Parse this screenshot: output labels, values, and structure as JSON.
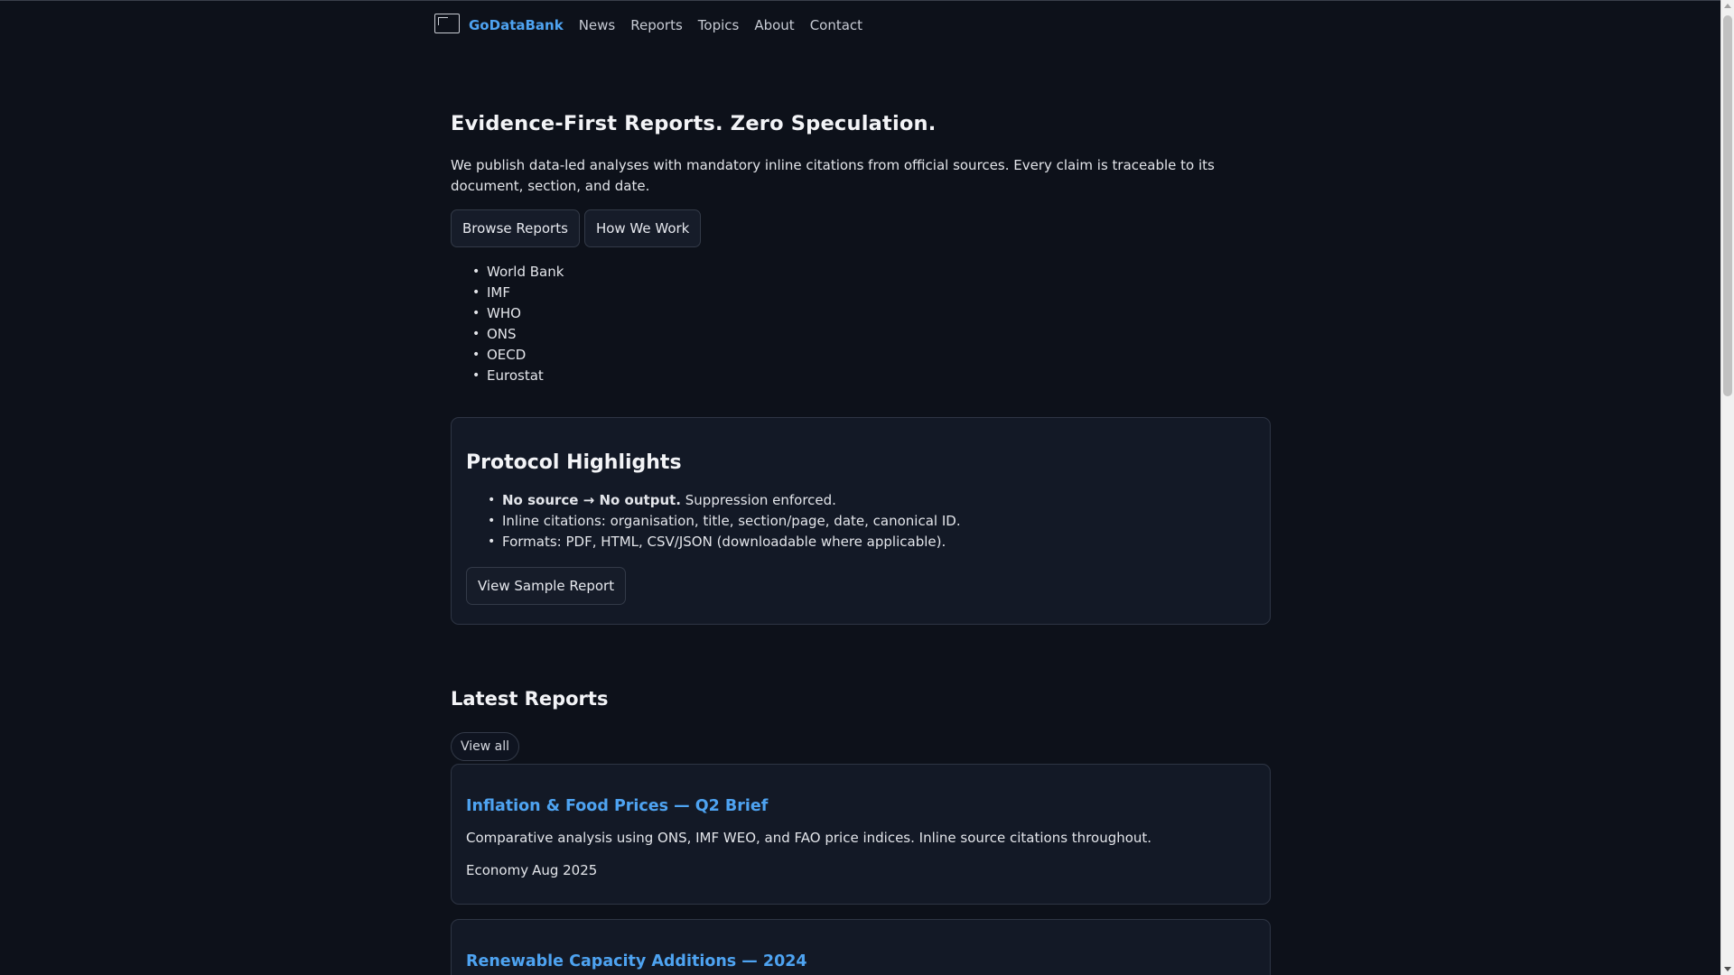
{
  "nav": {
    "brand": "GoDataBank",
    "links": [
      "News",
      "Reports",
      "Topics",
      "About",
      "Contact"
    ]
  },
  "hero": {
    "title": "Evidence-First Reports. Zero Speculation.",
    "description": "We publish data-led analyses with mandatory inline citations from official sources. Every claim is traceable to its document, section, and date.",
    "browse_label": "Browse Reports",
    "how_label": "How We Work",
    "sources": [
      "World Bank",
      "IMF",
      "WHO",
      "ONS",
      "OECD",
      "Eurostat"
    ]
  },
  "protocol": {
    "title": "Protocol Highlights",
    "item1_bold": "No source → No output.",
    "item1_rest": " Suppression enforced.",
    "item2": "Inline citations: organisation, title, section/page, date, canonical ID.",
    "item3": "Formats: PDF, HTML, CSV/JSON (downloadable where applicable).",
    "sample_label": "View Sample Report"
  },
  "latest": {
    "title": "Latest Reports",
    "view_all": "View all",
    "reports": [
      {
        "title": "Inflation & Food Prices — Q2 Brief",
        "description": "Comparative analysis using ONS, IMF WEO, and FAO price indices. Inline source citations throughout.",
        "topic": "Economy",
        "date": "Aug 2025"
      },
      {
        "title": "Renewable Capacity Additions — 2024"
      }
    ]
  }
}
